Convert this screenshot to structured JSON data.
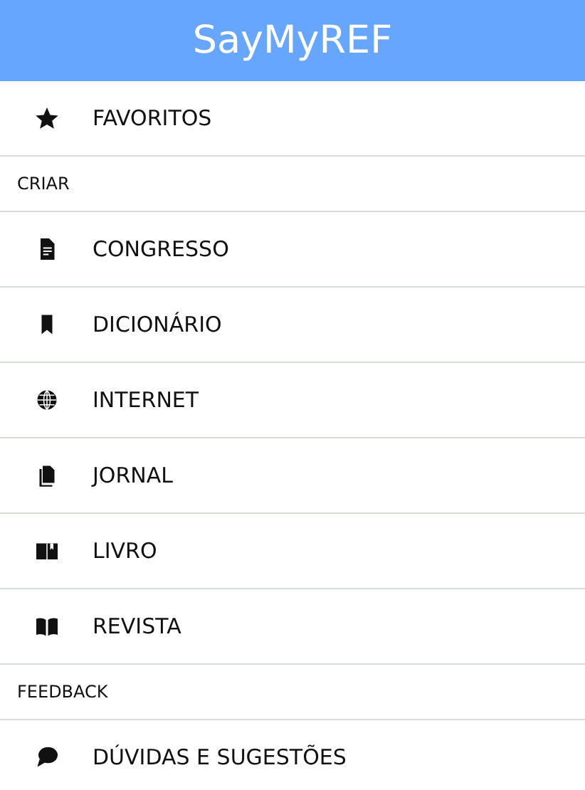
{
  "app_bar": {
    "title": "SayMyREF"
  },
  "sections": [
    {
      "items": [
        {
          "kind": "star",
          "label": "FAVORITOS"
        }
      ]
    },
    {
      "title": "CRIAR",
      "items": [
        {
          "kind": "document",
          "label": "CONGRESSO"
        },
        {
          "kind": "bookmark",
          "label": "DICIONÁRIO"
        },
        {
          "kind": "globe",
          "label": "INTERNET"
        },
        {
          "kind": "file",
          "label": "JORNAL"
        },
        {
          "kind": "book",
          "label": "LIVRO"
        },
        {
          "kind": "open-book",
          "label": "REVISTA"
        }
      ]
    },
    {
      "title": "FEEDBACK",
      "items": [
        {
          "kind": "chat",
          "label": "DÚVIDAS E SUGESTÕES"
        }
      ]
    }
  ]
}
